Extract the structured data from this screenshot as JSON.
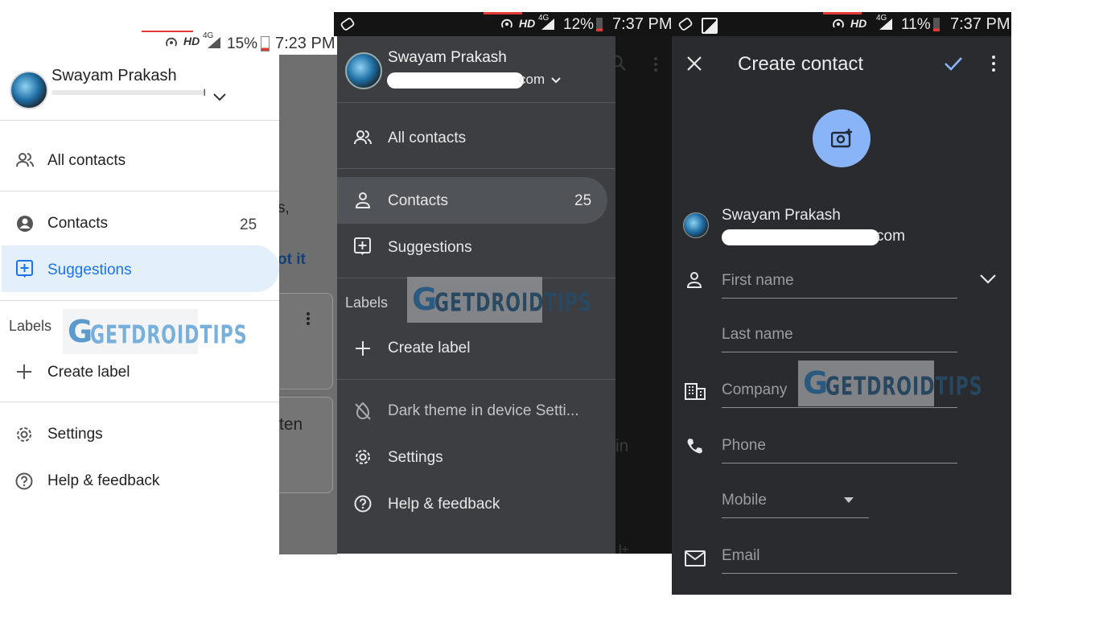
{
  "panel_light": {
    "status": {
      "signal_label": "HD",
      "network": "4G",
      "battery": "15%",
      "time": "7:23 PM"
    },
    "account": {
      "name": "Swayam Prakash",
      "email_partial": "ı"
    },
    "nav": {
      "all_contacts": "All contacts",
      "contacts": "Contacts",
      "contacts_count": "25",
      "suggestions": "Suggestions",
      "labels_header": "Labels",
      "create_label": "Create label",
      "settings": "Settings",
      "help": "Help & feedback"
    },
    "behind_text": {
      "t1": "s,",
      "t2": "ot it",
      "t3": "ten"
    },
    "colors": {
      "selected_bg": "#e3f0fc",
      "selected_text": "#1a73e8"
    }
  },
  "panel_dark_drawer": {
    "status": {
      "signal_label": "HD",
      "network": "4G",
      "battery": "12%",
      "time": "7:37 PM"
    },
    "account": {
      "name": "Swayam Prakash",
      "email_partial": "com"
    },
    "nav": {
      "all_contacts": "All contacts",
      "contacts": "Contacts",
      "contacts_count": "25",
      "suggestions": "Suggestions",
      "labels_header": "Labels",
      "create_label": "Create label",
      "dark_theme": "Dark theme in device Setti...",
      "settings": "Settings",
      "help": "Help & feedback"
    },
    "behind_text": {
      "t1": "in",
      "t2": "l+"
    }
  },
  "panel_create_contact": {
    "status": {
      "signal_label": "HD",
      "network": "4G",
      "battery": "11%",
      "time": "7:37 PM"
    },
    "title": "Create contact",
    "account": {
      "name": "Swayam Prakash",
      "email_partial": "com"
    },
    "fields": {
      "first_name": "First name",
      "last_name": "Last name",
      "company": "Company",
      "phone": "Phone",
      "phone_type": "Mobile",
      "email": "Email"
    },
    "colors": {
      "accent": "#8ab4f8",
      "background": "#2a2b2e"
    }
  },
  "watermark": {
    "text": "GETDROIDTIPS",
    "logo_letter": "G"
  }
}
